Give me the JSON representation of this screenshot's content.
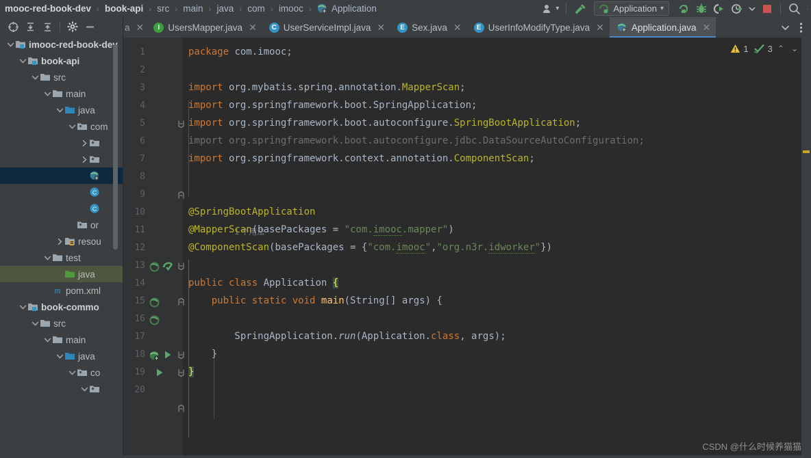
{
  "window": {
    "breadcrumbs": [
      {
        "label": "mooc-red-book-dev",
        "bold": true
      },
      {
        "label": "book-api",
        "bold": true
      },
      {
        "label": "src",
        "bold": false
      },
      {
        "label": "main",
        "bold": false
      },
      {
        "label": "java",
        "bold": false
      },
      {
        "label": "com",
        "bold": false
      },
      {
        "label": "imooc",
        "bold": false
      },
      {
        "label": "Application",
        "bold": false,
        "icon": "spring-boot-class-icon"
      }
    ]
  },
  "toolbar": {
    "account_icon": "user-account-icon",
    "account_caret": "▾",
    "build_icon": "hammer-build-icon",
    "run_config": {
      "icon": "spring-boot-run-icon",
      "label": "Application",
      "caret": "▾"
    },
    "actions": [
      {
        "name": "rerun-icon",
        "title": "Rerun"
      },
      {
        "name": "debug-icon",
        "title": "Debug"
      },
      {
        "name": "run-with-coverage-icon",
        "title": "Run with Coverage"
      },
      {
        "name": "profiler-icon",
        "title": "Profiler"
      },
      {
        "name": "profiler-dropdown-icon",
        "title": "Profiler options"
      },
      {
        "name": "stop-icon",
        "title": "Stop"
      },
      {
        "name": "search-everywhere-icon",
        "title": "Search Everywhere"
      },
      {
        "name": "settings-icon",
        "title": "Settings"
      }
    ]
  },
  "project_panel": {
    "toolbar_buttons": [
      {
        "name": "select-opened-file-icon",
        "glyph": "⊕"
      },
      {
        "name": "expand-all-icon",
        "glyph": "⤓"
      },
      {
        "name": "collapse-all-icon",
        "glyph": "⤒"
      },
      {
        "name": "settings-gear-icon",
        "glyph": "⚙"
      },
      {
        "name": "hide-panel-icon",
        "glyph": "—"
      }
    ],
    "tree": [
      {
        "label": "imooc-red-book-dev",
        "depth": 0,
        "twist": "v",
        "icon": "module-folder-icon",
        "bold": true,
        "state": "none"
      },
      {
        "label": "book-api",
        "depth": 1,
        "twist": "v",
        "icon": "module-folder-icon",
        "bold": true,
        "state": "none"
      },
      {
        "label": "src",
        "depth": 2,
        "twist": "v",
        "icon": "folder-icon",
        "bold": false,
        "state": "none"
      },
      {
        "label": "main",
        "depth": 3,
        "twist": "v",
        "icon": "folder-icon",
        "bold": false,
        "state": "none"
      },
      {
        "label": "java",
        "depth": 4,
        "twist": "v",
        "icon": "source-root-folder-icon",
        "bold": false,
        "state": "none"
      },
      {
        "label": "com",
        "depth": 5,
        "twist": "v",
        "icon": "package-icon",
        "bold": false,
        "state": "none"
      },
      {
        "label": "",
        "depth": 6,
        "twist": ">",
        "icon": "package-icon",
        "bold": false,
        "state": "none"
      },
      {
        "label": "",
        "depth": 6,
        "twist": ">",
        "icon": "package-icon",
        "bold": false,
        "state": "none"
      },
      {
        "label": "",
        "depth": 6,
        "twist": "",
        "icon": "spring-boot-class-icon",
        "bold": false,
        "state": "selected-blue"
      },
      {
        "label": "",
        "depth": 6,
        "twist": "",
        "icon": "java-class-icon",
        "bold": false,
        "state": "none"
      },
      {
        "label": "",
        "depth": 6,
        "twist": "",
        "icon": "java-class-icon",
        "bold": false,
        "state": "none"
      },
      {
        "label": "or",
        "depth": 5,
        "twist": "",
        "icon": "package-icon",
        "bold": false,
        "state": "none"
      },
      {
        "label": "resou",
        "depth": 4,
        "twist": ">",
        "icon": "resources-folder-icon",
        "bold": false,
        "state": "none"
      },
      {
        "label": "test",
        "depth": 3,
        "twist": "v",
        "icon": "folder-icon",
        "bold": false,
        "state": "none"
      },
      {
        "label": "java",
        "depth": 4,
        "twist": "",
        "icon": "test-source-folder-icon",
        "bold": false,
        "state": "selected-green"
      },
      {
        "label": "pom.xml",
        "depth": 3,
        "twist": "",
        "icon": "maven-pom-icon",
        "bold": false,
        "state": "none"
      },
      {
        "label": "book-commo",
        "depth": 1,
        "twist": "v",
        "icon": "module-folder-icon",
        "bold": true,
        "state": "none"
      },
      {
        "label": "src",
        "depth": 2,
        "twist": "v",
        "icon": "folder-icon",
        "bold": false,
        "state": "none"
      },
      {
        "label": "main",
        "depth": 3,
        "twist": "v",
        "icon": "folder-icon",
        "bold": false,
        "state": "none"
      },
      {
        "label": "java",
        "depth": 4,
        "twist": "v",
        "icon": "source-root-folder-icon",
        "bold": false,
        "state": "none"
      },
      {
        "label": "co",
        "depth": 5,
        "twist": "v",
        "icon": "package-icon",
        "bold": false,
        "state": "none"
      },
      {
        "label": "",
        "depth": 6,
        "twist": "v",
        "icon": "package-icon",
        "bold": false,
        "state": "none"
      }
    ]
  },
  "editor_tabs": {
    "tabs": [
      {
        "label": "UsersMapper.java",
        "badge": "I",
        "badge_color": "#3d9e3d",
        "active": false,
        "close": "✕"
      },
      {
        "label": "UserServiceImpl.java",
        "badge": "C",
        "badge_color": "#3592c4",
        "active": false,
        "close": "✕"
      },
      {
        "label": "Sex.java",
        "badge": "E",
        "badge_color": "#3592c4",
        "active": false,
        "close": "✕"
      },
      {
        "label": "UserInfoModifyType.java",
        "badge": "E",
        "badge_color": "#3592c4",
        "active": false,
        "close": "✕"
      },
      {
        "label": "Application.java",
        "badge": "S",
        "badge_color": "#3592c4",
        "active": true,
        "close": "✕"
      }
    ],
    "partial_left_close": "✕",
    "tail": [
      {
        "name": "tab-list-dropdown-icon",
        "glyph": "⌄"
      },
      {
        "name": "tab-options-icon",
        "glyph": "⋮"
      }
    ]
  },
  "inspection_hud": {
    "warning_icon": "warning-triangle-icon",
    "warning_count": "1",
    "ok_icon": "weak-warning-check-icon",
    "ok_count": "3",
    "prev_glyph": "⌃",
    "next_glyph": "⌄"
  },
  "code": {
    "usage_hint_line": "1 个用法",
    "lines": [
      {
        "n": "1",
        "tokens": [
          {
            "t": "package",
            "c": "kw"
          },
          {
            "t": " com.imooc;",
            "c": ""
          }
        ]
      },
      {
        "n": "2",
        "tokens": []
      },
      {
        "n": "3",
        "tokens": [
          {
            "t": "import",
            "c": "kw"
          },
          {
            "t": " org.mybatis.spring.annotation.",
            "c": ""
          },
          {
            "t": "MapperScan",
            "c": "ann"
          },
          {
            "t": ";",
            "c": ""
          }
        ]
      },
      {
        "n": "4",
        "tokens": [
          {
            "t": "import",
            "c": "kw"
          },
          {
            "t": " org.springframework.boot.SpringApplication;",
            "c": ""
          }
        ]
      },
      {
        "n": "5",
        "tokens": [
          {
            "t": "import",
            "c": "kw"
          },
          {
            "t": " org.springframework.boot.autoconfigure.",
            "c": ""
          },
          {
            "t": "SpringBootApplication",
            "c": "ann"
          },
          {
            "t": ";",
            "c": ""
          }
        ]
      },
      {
        "n": "6",
        "tokens": [
          {
            "t": "import org.springframework.boot.autoconfigure.jdbc.DataSourceAutoConfiguration;",
            "c": "grey"
          }
        ]
      },
      {
        "n": "7",
        "tokens": [
          {
            "t": "import",
            "c": "kw"
          },
          {
            "t": " org.springframework.context.annotation.",
            "c": ""
          },
          {
            "t": "ComponentScan",
            "c": "ann"
          },
          {
            "t": ";",
            "c": ""
          }
        ]
      },
      {
        "n": "8",
        "tokens": []
      },
      {
        "n": "9",
        "tokens": []
      },
      {
        "n": "10",
        "tokens": [
          {
            "t": "@SpringBootApplication",
            "c": "ann"
          }
        ]
      },
      {
        "n": "11",
        "tokens": [
          {
            "t": "@MapperScan",
            "c": "ann"
          },
          {
            "t": "(basePackages = ",
            "c": ""
          },
          {
            "t": "\"com.imooc.mapper\"",
            "c": "str"
          },
          {
            "t": ")",
            "c": ""
          }
        ]
      },
      {
        "n": "12",
        "tokens": [
          {
            "t": "@ComponentScan",
            "c": "ann"
          },
          {
            "t": "(basePackages = {",
            "c": ""
          },
          {
            "t": "\"com.imooc\"",
            "c": "str"
          },
          {
            "t": ",",
            "c": ""
          },
          {
            "t": "\"org.n3r.idworker\"",
            "c": "str"
          },
          {
            "t": "})",
            "c": ""
          }
        ]
      },
      {
        "n": "13",
        "tokens": []
      },
      {
        "n": "14",
        "tokens": [
          {
            "t": "public",
            "c": "kw"
          },
          {
            "t": " ",
            "c": ""
          },
          {
            "t": "class",
            "c": "kw"
          },
          {
            "t": " Application ",
            "c": ""
          },
          {
            "t": "{",
            "c": "brace-hl"
          }
        ]
      },
      {
        "n": "15",
        "tokens": [
          {
            "t": "    ",
            "c": ""
          },
          {
            "t": "public",
            "c": "kw"
          },
          {
            "t": " ",
            "c": ""
          },
          {
            "t": "static",
            "c": "kw"
          },
          {
            "t": " ",
            "c": ""
          },
          {
            "t": "void",
            "c": "kw"
          },
          {
            "t": " ",
            "c": ""
          },
          {
            "t": "main",
            "c": "fn"
          },
          {
            "t": "(String[] args) {",
            "c": ""
          }
        ]
      },
      {
        "n": "16",
        "tokens": []
      },
      {
        "n": "17",
        "tokens": [
          {
            "t": "        SpringApplication.",
            "c": ""
          },
          {
            "t": "run",
            "c": "italic"
          },
          {
            "t": "(Application.",
            "c": ""
          },
          {
            "t": "class",
            "c": "kw"
          },
          {
            "t": ", args);",
            "c": ""
          }
        ]
      },
      {
        "n": "18",
        "tokens": [
          {
            "t": "    }",
            "c": ""
          }
        ]
      },
      {
        "n": "19",
        "tokens": [
          {
            "t": "}",
            "c": "brace-hl"
          }
        ]
      },
      {
        "n": "20",
        "tokens": []
      }
    ]
  },
  "watermark": {
    "text": "CSDN @什么时候养猫猫"
  },
  "colors": {
    "bg_panel": "#3c3f41",
    "bg_editor": "#2b2b2b",
    "gutter": "#313335",
    "accent_tab": "#4a88c7",
    "selection_blue": "#0d293e",
    "selection_green": "#4e5640",
    "keyword": "#cc7832",
    "annotation": "#bbb529",
    "string": "#6a8759",
    "method": "#ffc66d",
    "warning": "#e8bf3c",
    "run_green": "#59a869",
    "stop_red": "#c75450"
  }
}
